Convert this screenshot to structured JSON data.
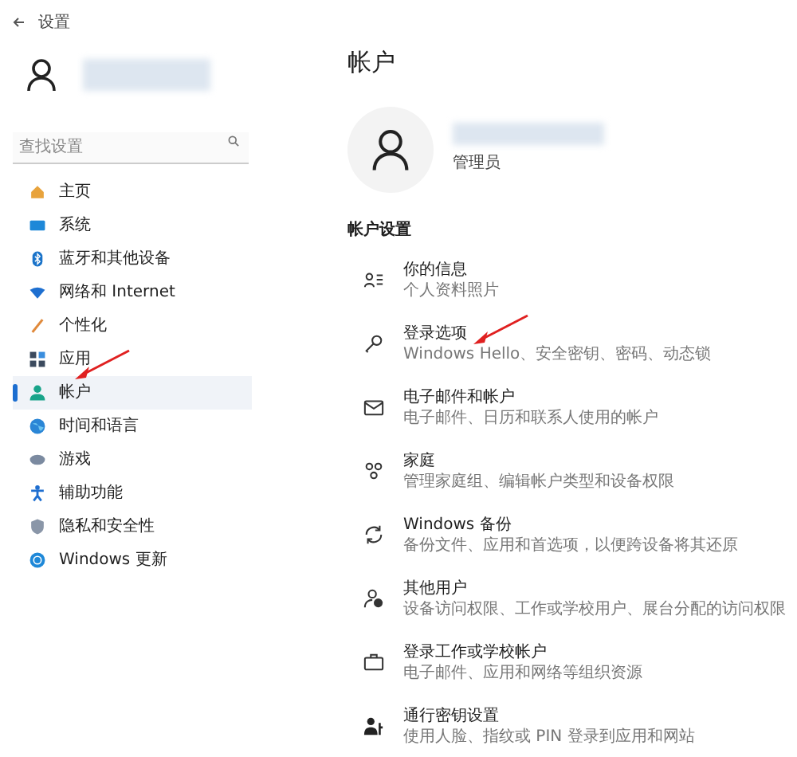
{
  "window": {
    "title": "设置"
  },
  "search": {
    "placeholder": "查找设置"
  },
  "sidebar": {
    "items": [
      {
        "label": "主页",
        "selected": false
      },
      {
        "label": "系统",
        "selected": false
      },
      {
        "label": "蓝牙和其他设备",
        "selected": false
      },
      {
        "label": "网络和 Internet",
        "selected": false
      },
      {
        "label": "个性化",
        "selected": false
      },
      {
        "label": "应用",
        "selected": false
      },
      {
        "label": "帐户",
        "selected": true
      },
      {
        "label": "时间和语言",
        "selected": false
      },
      {
        "label": "游戏",
        "selected": false
      },
      {
        "label": "辅助功能",
        "selected": false
      },
      {
        "label": "隐私和安全性",
        "selected": false
      },
      {
        "label": "Windows 更新",
        "selected": false
      }
    ]
  },
  "page": {
    "title": "帐户",
    "account_role": "管理员",
    "section_title": "帐户设置",
    "items": [
      {
        "title": "你的信息",
        "subtitle": "个人资料照片"
      },
      {
        "title": "登录选项",
        "subtitle": "Windows Hello、安全密钥、密码、动态锁"
      },
      {
        "title": "电子邮件和帐户",
        "subtitle": "电子邮件、日历和联系人使用的帐户"
      },
      {
        "title": "家庭",
        "subtitle": "管理家庭组、编辑帐户类型和设备权限"
      },
      {
        "title": "Windows 备份",
        "subtitle": "备份文件、应用和首选项，以便跨设备将其还原"
      },
      {
        "title": "其他用户",
        "subtitle": "设备访问权限、工作或学校用户、展台分配的访问权限"
      },
      {
        "title": "登录工作或学校帐户",
        "subtitle": "电子邮件、应用和网络等组织资源"
      },
      {
        "title": "通行密钥设置",
        "subtitle": "使用人脸、指纹或 PIN 登录到应用和网站"
      }
    ]
  }
}
